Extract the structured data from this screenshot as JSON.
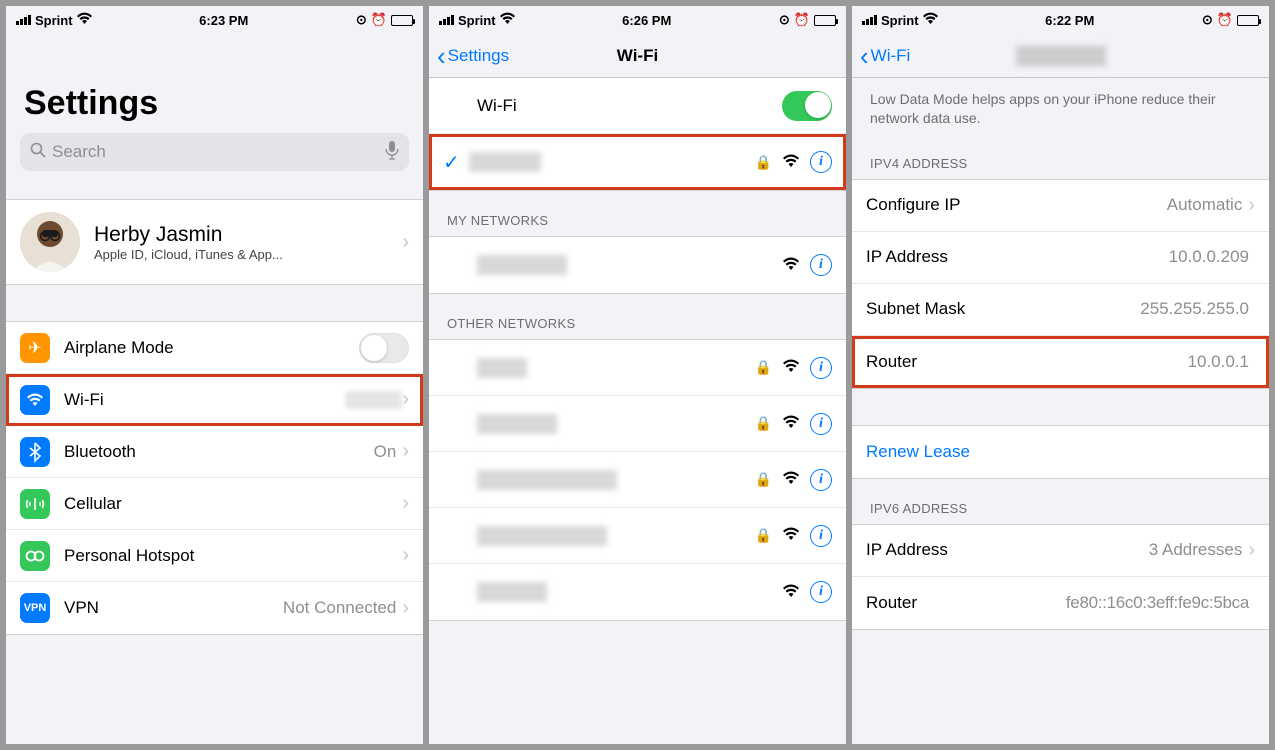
{
  "screen1": {
    "status": {
      "carrier": "Sprint",
      "time": "6:23 PM"
    },
    "title": "Settings",
    "search_placeholder": "Search",
    "profile": {
      "name": "Herby Jasmin",
      "subtitle": "Apple ID, iCloud, iTunes & App..."
    },
    "rows": {
      "airplane": "Airplane Mode",
      "wifi": "Wi-Fi",
      "bluetooth": "Bluetooth",
      "bluetooth_value": "On",
      "cellular": "Cellular",
      "hotspot": "Personal Hotspot",
      "vpn": "VPN",
      "vpn_value": "Not Connected"
    }
  },
  "screen2": {
    "status": {
      "carrier": "Sprint",
      "time": "6:26 PM"
    },
    "back": "Settings",
    "title": "Wi-Fi",
    "wifi_label": "Wi-Fi",
    "sections": {
      "my_networks": "MY NETWORKS",
      "other_networks": "OTHER NETWORKS"
    }
  },
  "screen3": {
    "status": {
      "carrier": "Sprint",
      "time": "6:22 PM"
    },
    "back": "Wi-Fi",
    "description": "Low Data Mode helps apps on your iPhone reduce their network data use.",
    "sections": {
      "ipv4": "IPV4 ADDRESS",
      "ipv6": "IPV6 ADDRESS"
    },
    "rows": {
      "configure_ip": "Configure IP",
      "configure_ip_value": "Automatic",
      "ip_address": "IP Address",
      "ip_address_value": "10.0.0.209",
      "subnet": "Subnet Mask",
      "subnet_value": "255.255.255.0",
      "router": "Router",
      "router_value": "10.0.0.1",
      "renew": "Renew Lease",
      "ip6_address": "IP Address",
      "ip6_value": "3 Addresses",
      "router6": "Router",
      "router6_value": "fe80::16c0:3eff:fe9c:5bca"
    }
  }
}
